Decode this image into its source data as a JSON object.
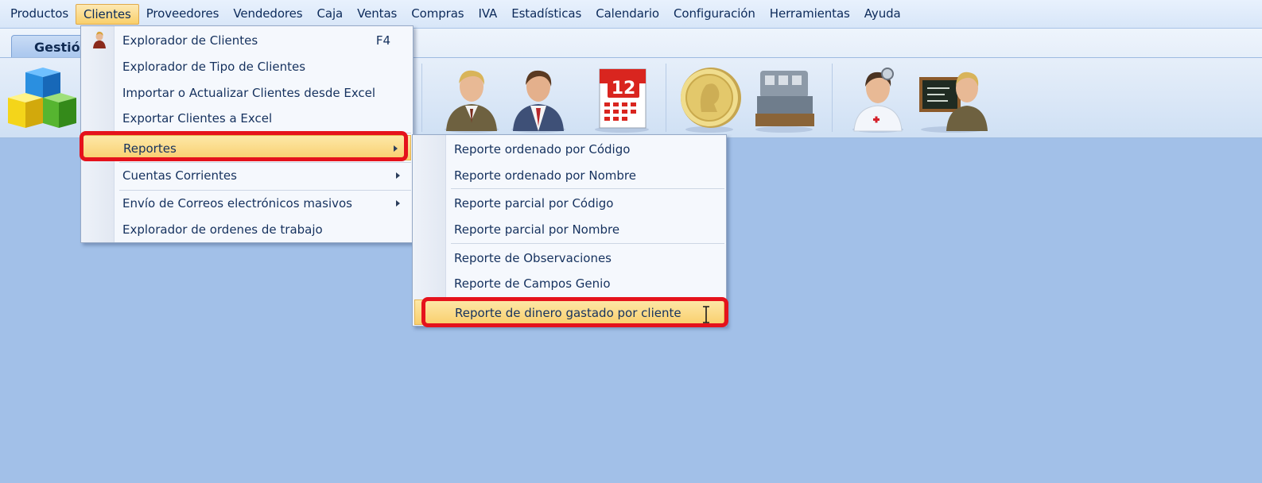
{
  "menubar": {
    "items": [
      {
        "label": "Productos"
      },
      {
        "label": "Clientes"
      },
      {
        "label": "Proveedores"
      },
      {
        "label": "Vendedores"
      },
      {
        "label": "Caja"
      },
      {
        "label": "Ventas"
      },
      {
        "label": "Compras"
      },
      {
        "label": "IVA"
      },
      {
        "label": "Estadísticas"
      },
      {
        "label": "Calendario"
      },
      {
        "label": "Configuración"
      },
      {
        "label": "Herramientas"
      },
      {
        "label": "Ayuda"
      }
    ],
    "active_index": 1
  },
  "ribbon": {
    "tab_label": "Gestió"
  },
  "clientes_menu": {
    "items": [
      {
        "label": "Explorador de Clientes",
        "shortcut": "F4"
      },
      {
        "label": "Explorador de Tipo de Clientes"
      },
      {
        "label": "Importar o Actualizar Clientes desde Excel"
      },
      {
        "label": "Exportar Clientes a Excel"
      },
      {
        "label": "Reportes"
      },
      {
        "label": "Cuentas Corrientes"
      },
      {
        "label": "Envío de Correos electrónicos masivos"
      },
      {
        "label": "Explorador de ordenes de trabajo"
      }
    ]
  },
  "reportes_menu": {
    "items": [
      {
        "label": "Reporte ordenado por Código"
      },
      {
        "label": "Reporte ordenado por Nombre"
      },
      {
        "label": "Reporte parcial por Código"
      },
      {
        "label": "Reporte parcial por Nombre"
      },
      {
        "label": "Reporte de Observaciones"
      },
      {
        "label": "Reporte de Campos Genio"
      },
      {
        "label": "Reporte de dinero gastado por cliente"
      }
    ]
  },
  "colors": {
    "background": "#a2c0e8",
    "highlight": "#f9cf6d",
    "annotation_red": "#e5121c"
  }
}
